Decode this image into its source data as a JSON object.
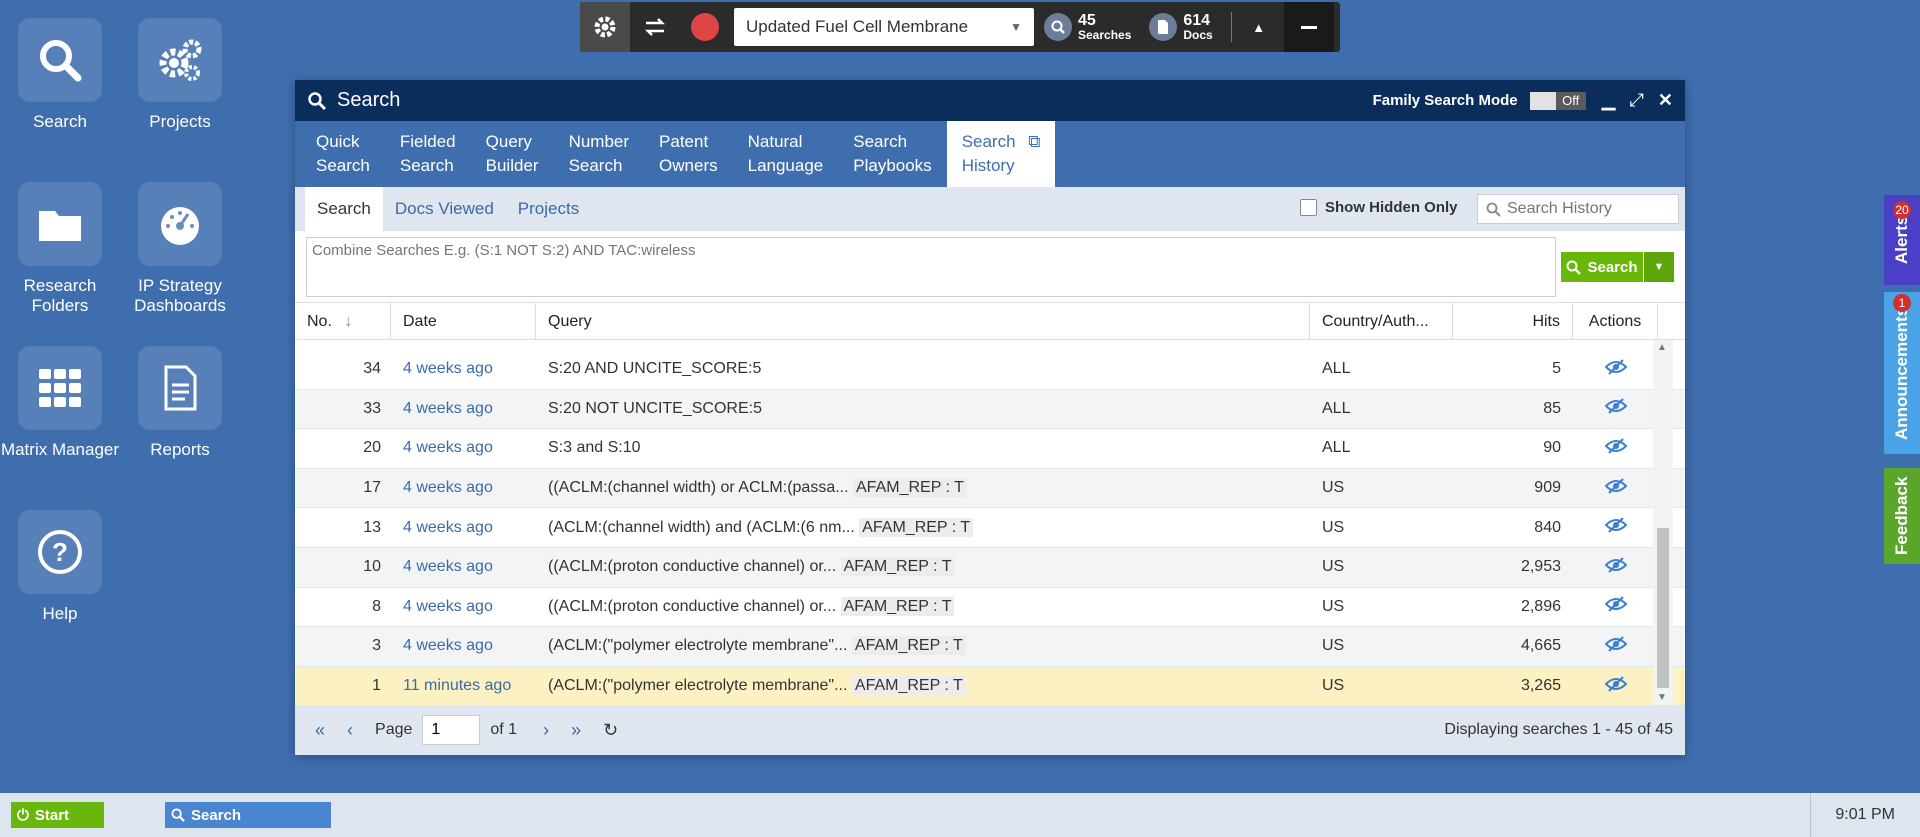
{
  "desktop": {
    "icons": [
      {
        "label": "Search"
      },
      {
        "label": "Projects"
      },
      {
        "label": "Research Folders"
      },
      {
        "label": "IP Strategy Dashboards"
      },
      {
        "label": "Matrix Manager"
      },
      {
        "label": "Reports"
      },
      {
        "label": "Help"
      }
    ]
  },
  "toolbar": {
    "project": "Updated Fuel Cell Membrane",
    "searches_count": "45",
    "searches_label": "Searches",
    "docs_count": "614",
    "docs_label": "Docs"
  },
  "window": {
    "title": "Search",
    "family_mode_label": "Family Search Mode",
    "family_mode_state": "Off",
    "tabs": [
      {
        "line1": "Quick",
        "line2": "Search"
      },
      {
        "line1": "Fielded",
        "line2": "Search"
      },
      {
        "line1": "Query",
        "line2": "Builder"
      },
      {
        "line1": "Number",
        "line2": "Search"
      },
      {
        "line1": "Patent",
        "line2": "Owners"
      },
      {
        "line1": "Natural",
        "line2": "Language"
      },
      {
        "line1": "Search",
        "line2": "Playbooks"
      },
      {
        "line1": "Search",
        "line2": "History"
      }
    ],
    "subtabs": [
      "Search",
      "Docs Viewed",
      "Projects"
    ],
    "show_hidden_label": "Show Hidden Only",
    "history_search_placeholder": "Search History",
    "combine_placeholder": "Combine Searches E.g. (S:1 NOT S:2) AND TAC:wireless",
    "search_button": "Search"
  },
  "grid": {
    "columns": [
      "No.",
      "Date",
      "Query",
      "Country/Auth...",
      "Hits",
      "Actions"
    ],
    "rows": [
      {
        "no": "34",
        "date": "4 weeks ago",
        "query": "S:20 AND UNCITE_SCORE:5",
        "tag": "",
        "country": "ALL",
        "hits": "5"
      },
      {
        "no": "33",
        "date": "4 weeks ago",
        "query": "S:20 NOT UNCITE_SCORE:5",
        "tag": "",
        "country": "ALL",
        "hits": "85"
      },
      {
        "no": "20",
        "date": "4 weeks ago",
        "query": "S:3 and S:10",
        "tag": "",
        "country": "ALL",
        "hits": "90"
      },
      {
        "no": "17",
        "date": "4 weeks ago",
        "query": "((ACLM:(channel width) or ACLM:(passa...",
        "tag": "AFAM_REP : T",
        "country": "US",
        "hits": "909"
      },
      {
        "no": "13",
        "date": "4 weeks ago",
        "query": "(ACLM:(channel width) and (ACLM:(6 nm...",
        "tag": "AFAM_REP : T",
        "country": "US",
        "hits": "840"
      },
      {
        "no": "10",
        "date": "4 weeks ago",
        "query": "((ACLM:(proton conductive channel) or...",
        "tag": "AFAM_REP : T",
        "country": "US",
        "hits": "2,953"
      },
      {
        "no": "8",
        "date": "4 weeks ago",
        "query": "((ACLM:(proton conductive channel) or...",
        "tag": "AFAM_REP : T",
        "country": "US",
        "hits": "2,896"
      },
      {
        "no": "3",
        "date": "4 weeks ago",
        "query": "(ACLM:(\"polymer electrolyte membrane\"...",
        "tag": "AFAM_REP : T",
        "country": "US",
        "hits": "4,665"
      },
      {
        "no": "1",
        "date": "11 minutes ago",
        "query": "(ACLM:(\"polymer electrolyte membrane\"...",
        "tag": "AFAM_REP : T",
        "country": "US",
        "hits": "3,265"
      }
    ]
  },
  "pager": {
    "page_label": "Page",
    "page_value": "1",
    "of_label": "of 1",
    "display_text": "Displaying searches 1 - 45 of 45"
  },
  "side": {
    "alerts_label": "Alerts",
    "alerts_count": "20",
    "announcements_label": "Announcements",
    "announcements_count": "1",
    "feedback_label": "Feedback"
  },
  "taskbar": {
    "start_label": "Start",
    "task_label": "Search",
    "clock": "9:01 PM"
  }
}
